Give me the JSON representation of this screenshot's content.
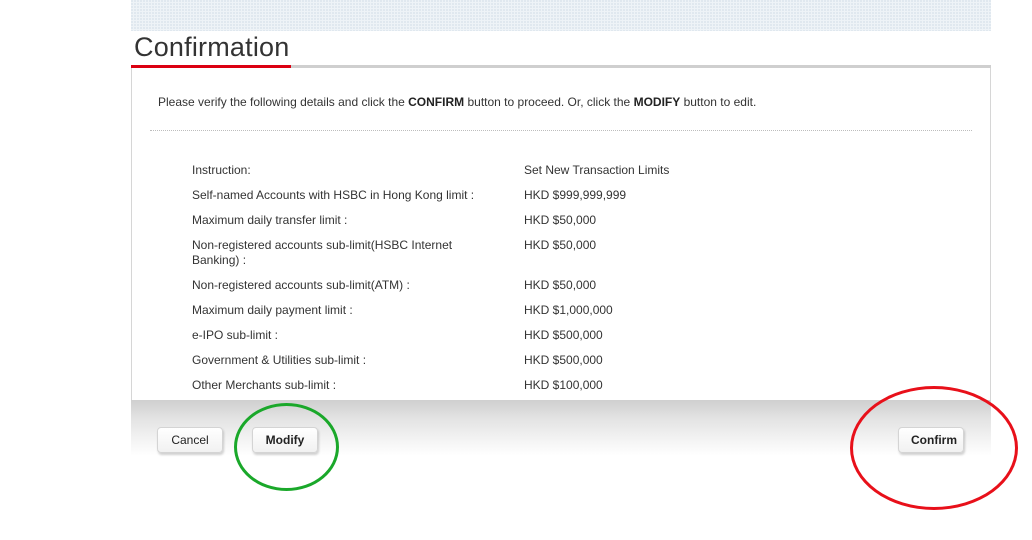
{
  "page": {
    "title": "Confirmation"
  },
  "intro": {
    "before_confirm": "Please verify the following details and click the ",
    "confirm_word": "CONFIRM",
    "middle": " button to proceed. Or, click the ",
    "modify_word": "MODIFY",
    "after_modify": " button to edit."
  },
  "details": [
    {
      "label": "Instruction:",
      "value": "Set New Transaction Limits"
    },
    {
      "label": "Self-named Accounts with HSBC in Hong Kong limit :",
      "value": "HKD $999,999,999"
    },
    {
      "label": "Maximum daily transfer limit :",
      "value": "HKD $50,000"
    },
    {
      "label": "Non-registered accounts sub-limit(HSBC Internet Banking) :",
      "value": "HKD $50,000"
    },
    {
      "label": "Non-registered accounts sub-limit(ATM) :",
      "value": "HKD $50,000"
    },
    {
      "label": "Maximum daily payment limit :",
      "value": "HKD $1,000,000"
    },
    {
      "label": "e-IPO sub-limit :",
      "value": "HKD $500,000"
    },
    {
      "label": "Government & Utilities sub-limit :",
      "value": "HKD $500,000"
    },
    {
      "label": "Other Merchants sub-limit :",
      "value": "HKD $100,000"
    }
  ],
  "buttons": {
    "cancel": "Cancel",
    "modify": "Modify",
    "confirm": "Confirm"
  },
  "colors": {
    "accent_red": "#db0011",
    "annotation_green": "#1aa82a",
    "annotation_red": "#e8101a"
  }
}
